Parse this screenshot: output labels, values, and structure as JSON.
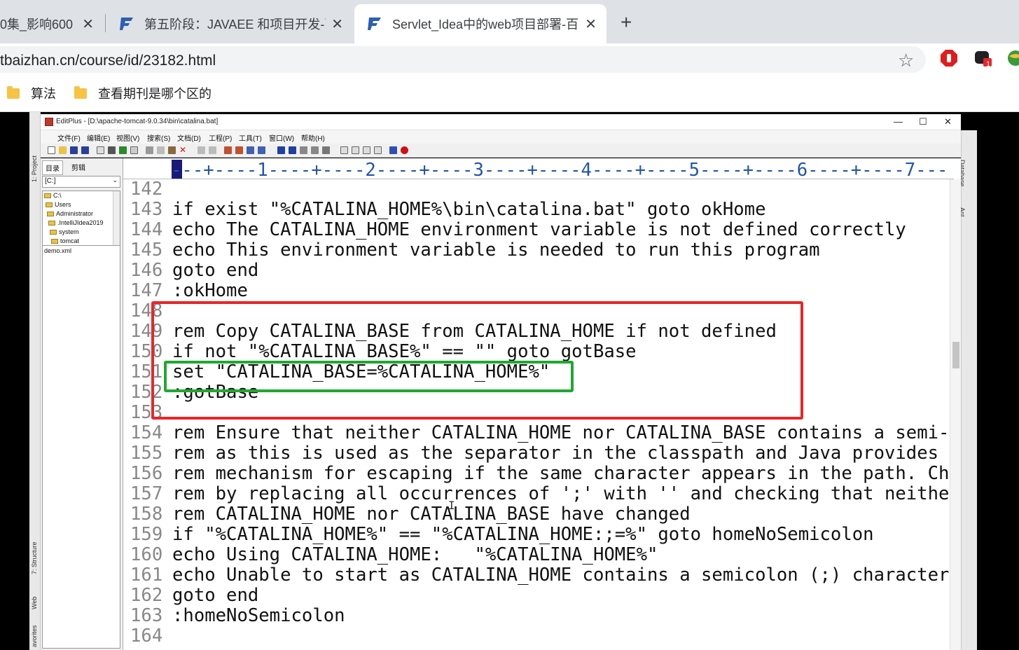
{
  "browser": {
    "tabs": [
      {
        "title": "0集_影响600",
        "active": false
      },
      {
        "title": "第五阶段：JAVAEE 和项目开发-百",
        "active": false
      },
      {
        "title": "Servlet_Idea中的web项目部署-百",
        "active": true
      }
    ],
    "new_tab_label": "+",
    "close_label": "✕",
    "url": "tbaizhan.cn/course/id/23182.html",
    "star_icon": "☆",
    "extension_badge": "1",
    "bookmarks": [
      {
        "label": "算法"
      },
      {
        "label": "查看期刊是哪个区的"
      }
    ]
  },
  "ide": {
    "left_strip_labels": [
      "1: Project",
      "7: Structure",
      "Web",
      "avorites"
    ],
    "right_strip_labels": [
      "Database",
      "Ant"
    ]
  },
  "editplus": {
    "title": "EditPlus - [D:\\apache-tomcat-9.0.34\\bin\\catalina.bat]",
    "window_buttons": {
      "minimize": "—",
      "maximize": "☐",
      "close": "✕"
    },
    "menus": [
      "文件(F)",
      "编辑(E)",
      "视图(V)",
      "搜索(S)",
      "文档(D)",
      "工程(P)",
      "工具(T)",
      "窗口(W)",
      "帮助(H)"
    ],
    "panel_tabs": [
      "目录",
      "剪辑"
    ],
    "drive": "[C:]",
    "tree": [
      "C:\\",
      "Users",
      "Administrator",
      ".IntelliJIdea2019",
      "system",
      "tomcat"
    ],
    "files": [
      "demo.xml"
    ],
    "ruler": "---+----1----+----2----+----3----+----4----+----5----+----6----+----7---",
    "lines": [
      {
        "no": "142",
        "text": ""
      },
      {
        "no": "143",
        "text": "if exist \"%CATALINA_HOME%\\bin\\catalina.bat\" goto okHome"
      },
      {
        "no": "144",
        "text": "echo The CATALINA_HOME environment variable is not defined correctly"
      },
      {
        "no": "145",
        "text": "echo This environment variable is needed to run this program"
      },
      {
        "no": "146",
        "text": "goto end"
      },
      {
        "no": "147",
        "text": ":okHome"
      },
      {
        "no": "148",
        "text": ""
      },
      {
        "no": "149",
        "text": "rem Copy CATALINA_BASE from CATALINA_HOME if not defined"
      },
      {
        "no": "150",
        "text": "if not \"%CATALINA_BASE%\" == \"\" goto gotBase"
      },
      {
        "no": "151",
        "text": "set \"CATALINA_BASE=%CATALINA_HOME%\""
      },
      {
        "no": "152",
        "text": ":gotBase"
      },
      {
        "no": "153",
        "text": ""
      },
      {
        "no": "154",
        "text": "rem Ensure that neither CATALINA_HOME nor CATALINA_BASE contains a semi-c"
      },
      {
        "no": "155",
        "text": "rem as this is used as the separator in the classpath and Java provides n"
      },
      {
        "no": "156",
        "text": "rem mechanism for escaping if the same character appears in the path. Che"
      },
      {
        "no": "157",
        "text": "rem by replacing all occurrences of ';' with '' and checking that neither"
      },
      {
        "no": "158",
        "text": "rem CATALINA_HOME nor CATALINA_BASE have changed"
      },
      {
        "no": "159",
        "text": "if \"%CATALINA_HOME%\" == \"%CATALINA_HOME:;=%\" goto homeNoSemicolon"
      },
      {
        "no": "160",
        "text": "echo Using CATALINA_HOME:   \"%CATALINA_HOME%\""
      },
      {
        "no": "161",
        "text": "echo Unable to start as CATALINA_HOME contains a semicolon (;) character"
      },
      {
        "no": "162",
        "text": "goto end"
      },
      {
        "no": "163",
        "text": ":homeNoSemicolon"
      },
      {
        "no": "164",
        "text": ""
      }
    ]
  },
  "colors": {
    "annotation_red": "#e8262a",
    "annotation_green": "#1fa832",
    "ruler_blue": "#2255aa"
  }
}
